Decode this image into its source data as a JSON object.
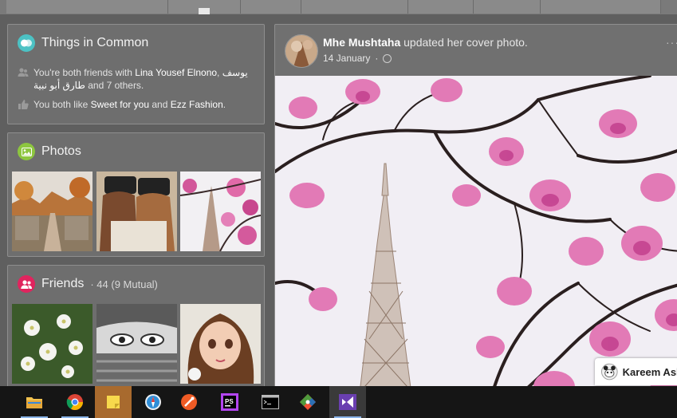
{
  "things_in_common": {
    "title": "Things in Common",
    "friends_prefix": "You're both friends with",
    "friend1": "Lina Yousef Elnono",
    "friend_sep": ",",
    "friend2": "يوسف طارق أبو نبية",
    "friends_suffix": "and 7 others.",
    "likes_prefix": "You both like",
    "like1": "Sweet for you",
    "likes_and": "and",
    "like2": "Ezz Fashion",
    "likes_end": "."
  },
  "photos": {
    "title": "Photos"
  },
  "friends": {
    "title": "Friends",
    "count_text": "· 44 (9 Mutual)"
  },
  "post": {
    "author": "Mhe Mushtaha",
    "action": "updated her cover photo.",
    "date": "14 January",
    "menu": "···"
  },
  "chat": {
    "name": "Kareem Ash"
  },
  "taskbar": {
    "apps": [
      {
        "icon": "file-explorer-icon"
      },
      {
        "icon": "chrome-icon"
      },
      {
        "icon": "sticky-notes-icon"
      },
      {
        "icon": "safari-compass-icon"
      },
      {
        "icon": "postman-icon"
      },
      {
        "icon": "phpstorm-icon"
      },
      {
        "icon": "command-prompt-icon"
      },
      {
        "icon": "sourcetree-icon"
      },
      {
        "icon": "visual-studio-icon"
      }
    ]
  },
  "colors": {
    "things_icon": "#4cc2c4",
    "photos_icon": "#8dc63f",
    "friends_icon": "#e0245e"
  }
}
